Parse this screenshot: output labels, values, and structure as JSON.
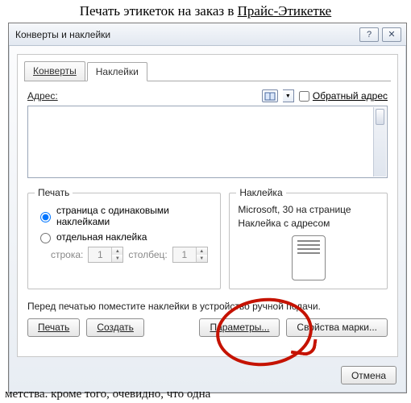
{
  "page_header": {
    "prefix": "Печать этикеток на заказ в ",
    "link": "Прайс-Этикетке"
  },
  "dialog": {
    "title": "Конверты и наклейки",
    "help_glyph": "?",
    "close_glyph": "✕"
  },
  "tabs": {
    "envelopes": "Конверты",
    "labels": "Наклейки"
  },
  "address": {
    "label": "Адрес:",
    "value": "",
    "return_checkbox": "Обратный адрес"
  },
  "print_group": {
    "title": "Печать",
    "opt_same": "страница с одинаковыми наклейками",
    "opt_single": "отдельная наклейка",
    "row_label": "строка:",
    "row_value": "1",
    "col_label": "столбец:",
    "col_value": "1"
  },
  "label_group": {
    "title": "Наклейка",
    "line1": "Microsoft, 30 на странице",
    "line2": "Наклейка с адресом"
  },
  "note": "Перед печатью поместите наклейки в устройство ручной подачи.",
  "buttons": {
    "print": "Печать",
    "create": "Создать",
    "options": "Параметры...",
    "brand": "Свойства марки...",
    "cancel": "Отмена"
  },
  "bg_text": "метства. кроме того, очевидно, что одна"
}
